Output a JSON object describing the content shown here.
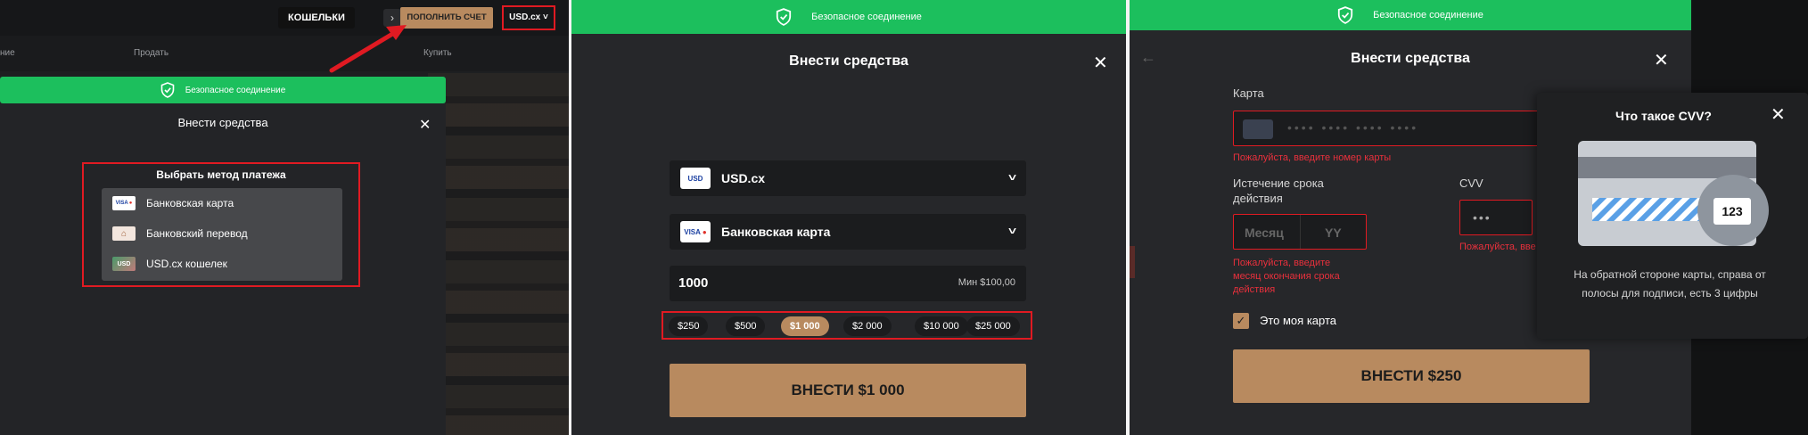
{
  "panel1": {
    "header": {
      "wallets_label": "КОШЕЛЬКИ",
      "arrow_label": "›",
      "topup_label": "ПОПОЛНИТЬ СЧЕТ",
      "currency_label": "USD.cx ˅"
    },
    "table_head": {
      "col1": "ние",
      "col2": "Продать",
      "col3": "Купить"
    },
    "secure_text": "Безопасное соединение",
    "modal_title": "Внести средства",
    "close_label": "✕",
    "method_title": "Выбрать метод платежа",
    "methods": [
      {
        "label": "Банковская карта",
        "icon": "visa-mastercard-icon"
      },
      {
        "label": "Банковский перевод",
        "icon": "bank-icon"
      },
      {
        "label": "USD.cx кошелек",
        "icon": "usd-wallet-icon"
      }
    ]
  },
  "panel2": {
    "secure_text": "Безопасное соединение",
    "title": "Внести средства",
    "close_label": "✕",
    "currency_select": "USD.cx",
    "method_select": "Банковская карта",
    "amount_value": "1000",
    "amount_min": "Мин $100,00",
    "presets": [
      "$250",
      "$500",
      "$1 000",
      "$2 000",
      "$10 000",
      "$25 000"
    ],
    "active_preset": "$1 000",
    "deposit_label": "ВНЕСТИ $1 000"
  },
  "panel3": {
    "secure_text": "Безопасное соединение",
    "title": "Внести средства",
    "close_label": "✕",
    "card_label": "Карта",
    "card_placeholder": "•••• •••• •••• ••••",
    "card_error": "Пожалуйста, введите номер карты",
    "expiry_label_1": "Истечение срока",
    "expiry_label_2": "действия",
    "month_placeholder": "Месяц",
    "year_placeholder": "YY",
    "expiry_error_1": "Пожалуйста, введите",
    "expiry_error_2": "месяц окончания срока",
    "expiry_error_3": "действия",
    "cvv_label": "CVV",
    "cvv_value": "•••",
    "cvv_error": "Пожалуйста, вве",
    "my_card_label": "Это моя карта",
    "deposit_label": "ВНЕСТИ  $250",
    "cvv_popup": {
      "title": "Что такое CVV?",
      "close_label": "✕",
      "card_number": "123",
      "text": "На обратной стороне карты, справа от полосы для подписи, есть 3 цифры"
    }
  },
  "colors": {
    "secure_green": "#1cbf5d",
    "accent_bronze": "#b88a5f",
    "error_red": "#e01a22",
    "modal_bg": "#26272a"
  }
}
